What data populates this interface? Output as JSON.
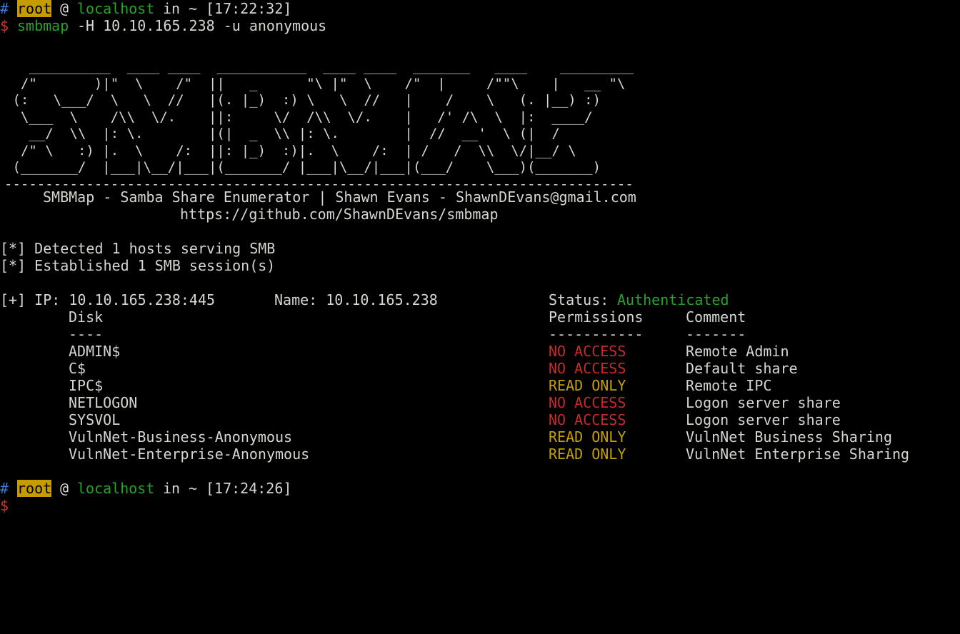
{
  "prompt1": {
    "hash": "#",
    "user": "root",
    "at": "@",
    "host": "localhost",
    "in": "in",
    "dir": "~",
    "time": "[17:22:32]"
  },
  "command": {
    "dollar": "$",
    "program": "smbmap",
    "args": "-H 10.10.165.238 -u anonymous"
  },
  "banner": {
    "art": "   __________  ____ ____  ___________  ____ ____  _______   ____    _________\n  /\"       )|\"  \\    /\"  ||   _      \"\\ |\"  \\    /\"  |     /\"\"\\    |   __ \"\\\n (:   \\___/  \\   \\  //   |(. |_)  :) \\   \\  //   |    /    \\   (. |__) :)\n  \\___  \\    /\\\\  \\/.    ||:     \\/  /\\\\  \\/.    |   /' /\\  \\  |:  ____/\n   __/  \\\\  |: \\.        |(|  _  \\\\ |: \\.        |  //  __'  \\ (|  /\n  /\" \\   :) |.  \\    /:  ||: |_)  :)|.  \\    /:  | /   /  \\\\  \\/|__/ \\\n (_______/  |___|\\__/|___|(_______/ |___|\\__/|___|(___/    \\___)(_______)\n-----------------------------------------------------------------------------",
    "title": "SMBMap - Samba Share Enumerator | Shawn Evans - ShawnDEvans@gmail.com",
    "url": "https://github.com/ShawnDEvans/smbmap"
  },
  "messages": {
    "detected": "[*] Detected 1 hosts serving SMB",
    "established": "[*] Established 1 SMB session(s)"
  },
  "host_info": {
    "ip": "[+] IP: 10.10.165.238:445",
    "name": "Name: 10.10.165.238",
    "status_label": "Status:",
    "status_value": "Authenticated"
  },
  "table": {
    "headers": {
      "disk": "Disk",
      "permissions": "Permissions",
      "comment": "Comment"
    },
    "underlines": {
      "disk": "----",
      "permissions": "-----------",
      "comment": "-------"
    },
    "colors": {
      "NO ACCESS": "#c42b2b",
      "READ ONLY": "#c4a000"
    },
    "rows": [
      {
        "disk": "ADMIN$",
        "permissions": "NO ACCESS",
        "comment": "Remote Admin"
      },
      {
        "disk": "C$",
        "permissions": "NO ACCESS",
        "comment": "Default share"
      },
      {
        "disk": "IPC$",
        "permissions": "READ ONLY",
        "comment": "Remote IPC"
      },
      {
        "disk": "NETLOGON",
        "permissions": "NO ACCESS",
        "comment": "Logon server share"
      },
      {
        "disk": "SYSVOL",
        "permissions": "NO ACCESS",
        "comment": "Logon server share"
      },
      {
        "disk": "VulnNet-Business-Anonymous",
        "permissions": "READ ONLY",
        "comment": "VulnNet Business Sharing"
      },
      {
        "disk": "VulnNet-Enterprise-Anonymous",
        "permissions": "READ ONLY",
        "comment": "VulnNet Enterprise Sharing"
      }
    ]
  },
  "prompt2": {
    "hash": "#",
    "user": "root",
    "at": "@",
    "host": "localhost",
    "in": "in",
    "dir": "~",
    "time": "[17:24:26]",
    "dollar": "$"
  }
}
